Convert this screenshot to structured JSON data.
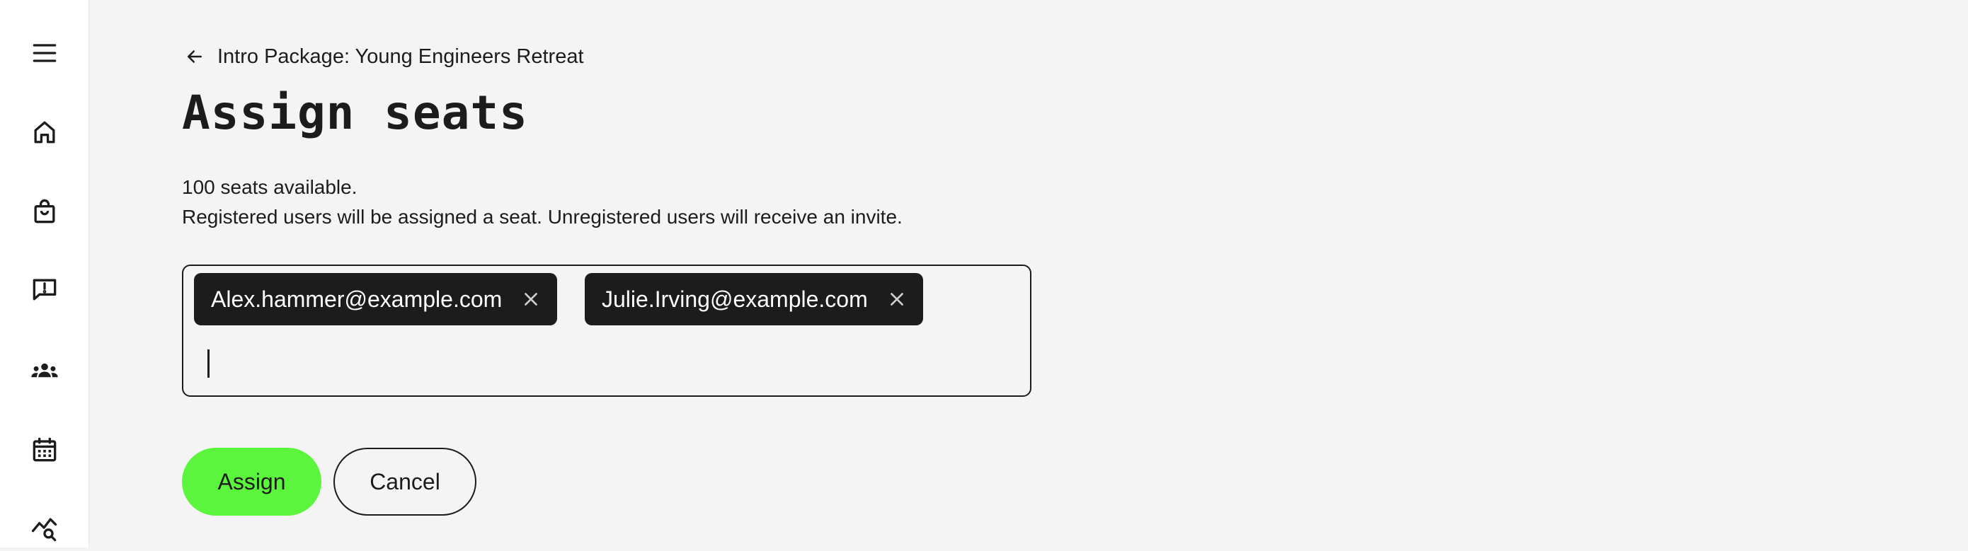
{
  "sidebar": {
    "items": [
      {
        "icon": "menu-icon"
      },
      {
        "icon": "home-icon"
      },
      {
        "icon": "shopping-bag-icon"
      },
      {
        "icon": "feedback-icon"
      },
      {
        "icon": "group-icon"
      },
      {
        "icon": "calendar-icon"
      },
      {
        "icon": "analytics-search-icon"
      }
    ]
  },
  "breadcrumb": {
    "back_icon": "arrow-left-icon",
    "label": "Intro Package: Young Engineers Retreat"
  },
  "page": {
    "title": "Assign seats",
    "seats_available": "100 seats available.",
    "description": "Registered users will be assigned a seat. Unregistered users will receive an invite."
  },
  "email_input": {
    "chips": [
      {
        "email": "Alex.hammer@example.com",
        "remove_icon": "close-icon"
      },
      {
        "email": "Julie.Irving@example.com",
        "remove_icon": "close-icon"
      }
    ],
    "value": ""
  },
  "actions": {
    "assign_label": "Assign",
    "cancel_label": "Cancel"
  },
  "colors": {
    "background": "#f4f4f4",
    "sidebar": "#ffffff",
    "chip": "#1c1c1c",
    "primary_button": "#5cf53d",
    "text": "#1c1c1c"
  }
}
